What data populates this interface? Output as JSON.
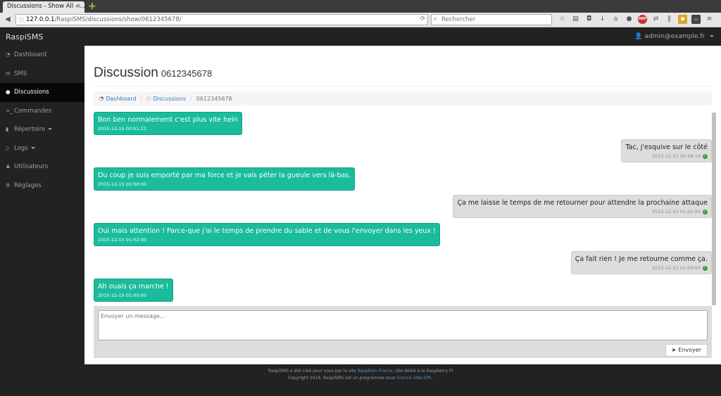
{
  "browser": {
    "tab_title": "Discussions - Show All - ...",
    "tab_close": "×",
    "new_tab": "+",
    "url_host": "127.0.0.1",
    "url_path": "/RaspiSMS/discussions/show/0612345678/",
    "search_placeholder": "Rechercher"
  },
  "app": {
    "brand": "RaspiSMS",
    "user": "admin@example.fr"
  },
  "sidebar": {
    "items": [
      {
        "label": "Dashboard",
        "icon": "dashboard-icon",
        "active": false
      },
      {
        "label": "SMS",
        "icon": "envelope-icon",
        "active": false
      },
      {
        "label": "Discussions",
        "icon": "comments-icon",
        "active": true
      },
      {
        "label": "Commandes",
        "icon": "terminal-icon",
        "active": false
      },
      {
        "label": "Répertoire",
        "icon": "book-icon",
        "active": false,
        "dropdown": true
      },
      {
        "label": "Logs",
        "icon": "file-icon",
        "active": false,
        "dropdown": true
      },
      {
        "label": "Utilisateurs",
        "icon": "user-icon",
        "active": false
      },
      {
        "label": "Réglages",
        "icon": "cogs-icon",
        "active": false
      }
    ]
  },
  "page": {
    "title": "Discussion",
    "subtitle": "0612345678"
  },
  "breadcrumb": {
    "dashboard": "Dashboard",
    "discussions": "Discussions",
    "current": "0612345678"
  },
  "messages": [
    {
      "dir": "in",
      "text": "Bon ben normalement c'est plus vite hein",
      "date": "2015-12-15 00:51:21"
    },
    {
      "dir": "out",
      "text": "Tac, j'esquive sur le côté",
      "date": "2015-12-15 00:58:19"
    },
    {
      "dir": "in",
      "text": "Du coup je suis emporté par ma force et je vais péter la gueule vers là-bas.",
      "date": "2015-12-15 01:00:00"
    },
    {
      "dir": "out",
      "text": "Ça me laisse le temps de me retourner pour attendre la prochaine attaque",
      "date": "2015-12-15 01:01:00"
    },
    {
      "dir": "in",
      "text": "Oui mais attention ! Parce-que j'ai le temps de prendre du sable et de vous l'envoyer dans les yeux !",
      "date": "2015-12-15 01:02:00"
    },
    {
      "dir": "out",
      "text": "Ça fait rien ! Je me retourne comme ça.",
      "date": "2015-12-15 01:03:00"
    },
    {
      "dir": "in",
      "text": "Ah ouais ça marche !",
      "date": "2015-12-15 01:05:00"
    }
  ],
  "compose": {
    "placeholder": "Envoyer un message...",
    "send_label": "Envoyer"
  },
  "footer": {
    "line1_prefix": "RaspiSMS a été créé pour vous par le site ",
    "line1_link": "Raspbian-France",
    "line1_suffix": ", site dédié à la Raspberry Pi",
    "line2_prefix": "Copyright 2014. RaspiSMS est un programme sous ",
    "line2_link": "licence GNU GPL",
    "line2_suffix": "."
  }
}
